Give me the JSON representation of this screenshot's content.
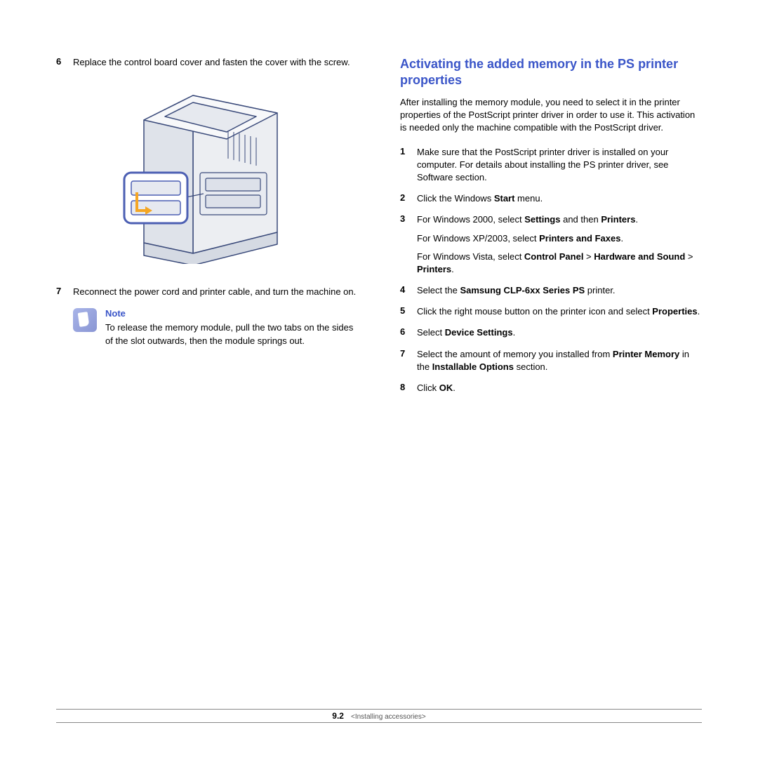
{
  "left": {
    "step6": {
      "num": "6",
      "text": "Replace the control board cover and fasten the cover with the screw."
    },
    "step7": {
      "num": "7",
      "text": "Reconnect the power cord and printer cable, and turn the machine on."
    },
    "note": {
      "title": "Note",
      "text": "To release the memory module, pull the two tabs on the sides of the slot outwards, then the module springs out."
    }
  },
  "right": {
    "heading": "Activating the added memory in the PS printer properties",
    "intro": "After installing the memory module, you need to select it in the printer properties of the PostScript printer driver in order to use it. This activation is needed only the machine compatible with the PostScript driver.",
    "s1": {
      "num": "1",
      "text": "Make sure that the PostScript printer driver is installed on your computer. For details about installing the PS printer driver, see Software section."
    },
    "s2": {
      "num": "2",
      "pre": "Click the Windows ",
      "b1": "Start",
      "post": " menu."
    },
    "s3": {
      "num": "3",
      "l1_pre": "For Windows 2000, select ",
      "l1_b1": "Settings",
      "l1_mid": " and then ",
      "l1_b2": "Printers",
      "l1_post": ".",
      "l2_pre": "For Windows XP/2003, select ",
      "l2_b1": "Printers and Faxes",
      "l2_post": ".",
      "l3_pre": "For Windows Vista, select ",
      "l3_b1": "Control Panel",
      "l3_g1": " > ",
      "l3_b2": "Hardware and Sound",
      "l3_g2": " > ",
      "l3_b3": "Printers",
      "l3_post": "."
    },
    "s4": {
      "num": "4",
      "pre": "Select the ",
      "b1": "Samsung CLP-6xx Series PS",
      "post": " printer."
    },
    "s5": {
      "num": "5",
      "pre": "Click the right mouse button on the printer icon and select ",
      "b1": "Properties",
      "post": "."
    },
    "s6": {
      "num": "6",
      "pre": "Select ",
      "b1": "Device Settings",
      "post": "."
    },
    "s7": {
      "num": "7",
      "pre": "Select the amount of memory you installed from ",
      "b1": "Printer Memory",
      "mid": " in the ",
      "b2": "Installable Options",
      "post": " section."
    },
    "s8": {
      "num": "8",
      "pre": "Click ",
      "b1": "OK",
      "post": "."
    }
  },
  "footer": {
    "page_bold": "9",
    "page_rest": ".2",
    "breadcrumb": "<Installing accessories>"
  }
}
